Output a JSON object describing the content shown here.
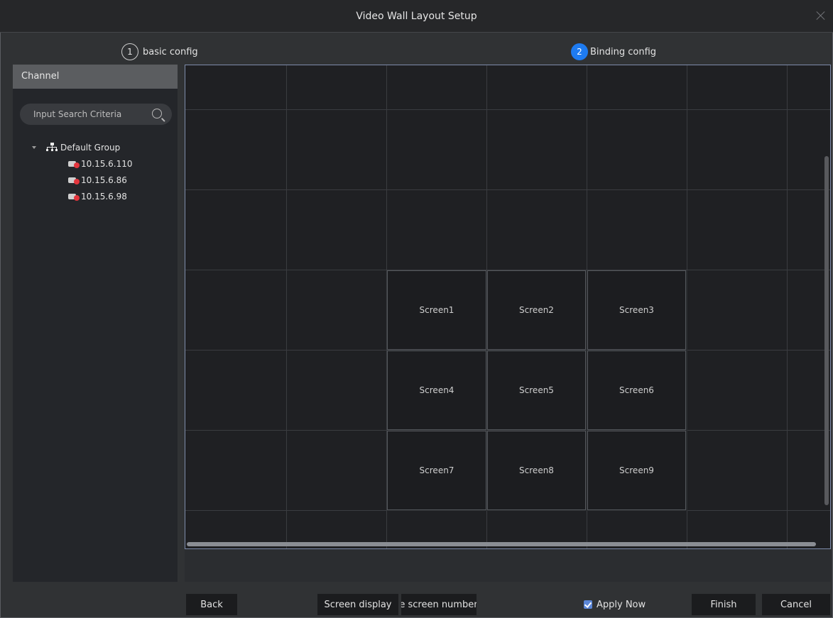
{
  "window": {
    "title": "Video Wall Layout Setup"
  },
  "steps": [
    {
      "number": "1",
      "label": "basic config"
    },
    {
      "number": "2",
      "label": "Binding config"
    }
  ],
  "sidebar": {
    "header": "Channel",
    "search": {
      "placeholder": "Input Search Criteria",
      "value": ""
    },
    "tree": {
      "group": "Default Group",
      "devices": [
        "10.15.6.110",
        "10.15.6.86",
        "10.15.6.98"
      ]
    }
  },
  "wall": {
    "screens": [
      "Screen1",
      "Screen2",
      "Screen3",
      "Screen4",
      "Screen5",
      "Screen6",
      "Screen7",
      "Screen8",
      "Screen9"
    ]
  },
  "footer": {
    "back": "Back",
    "screen_display": "Screen display",
    "screen_number": "the screen number",
    "apply_now": "Apply Now",
    "apply_checked": true,
    "finish": "Finish",
    "cancel": "Cancel"
  },
  "colors": {
    "accent": "#1e7bf0",
    "background": "#303234",
    "panel": "#24262a",
    "error": "#e3353d"
  }
}
